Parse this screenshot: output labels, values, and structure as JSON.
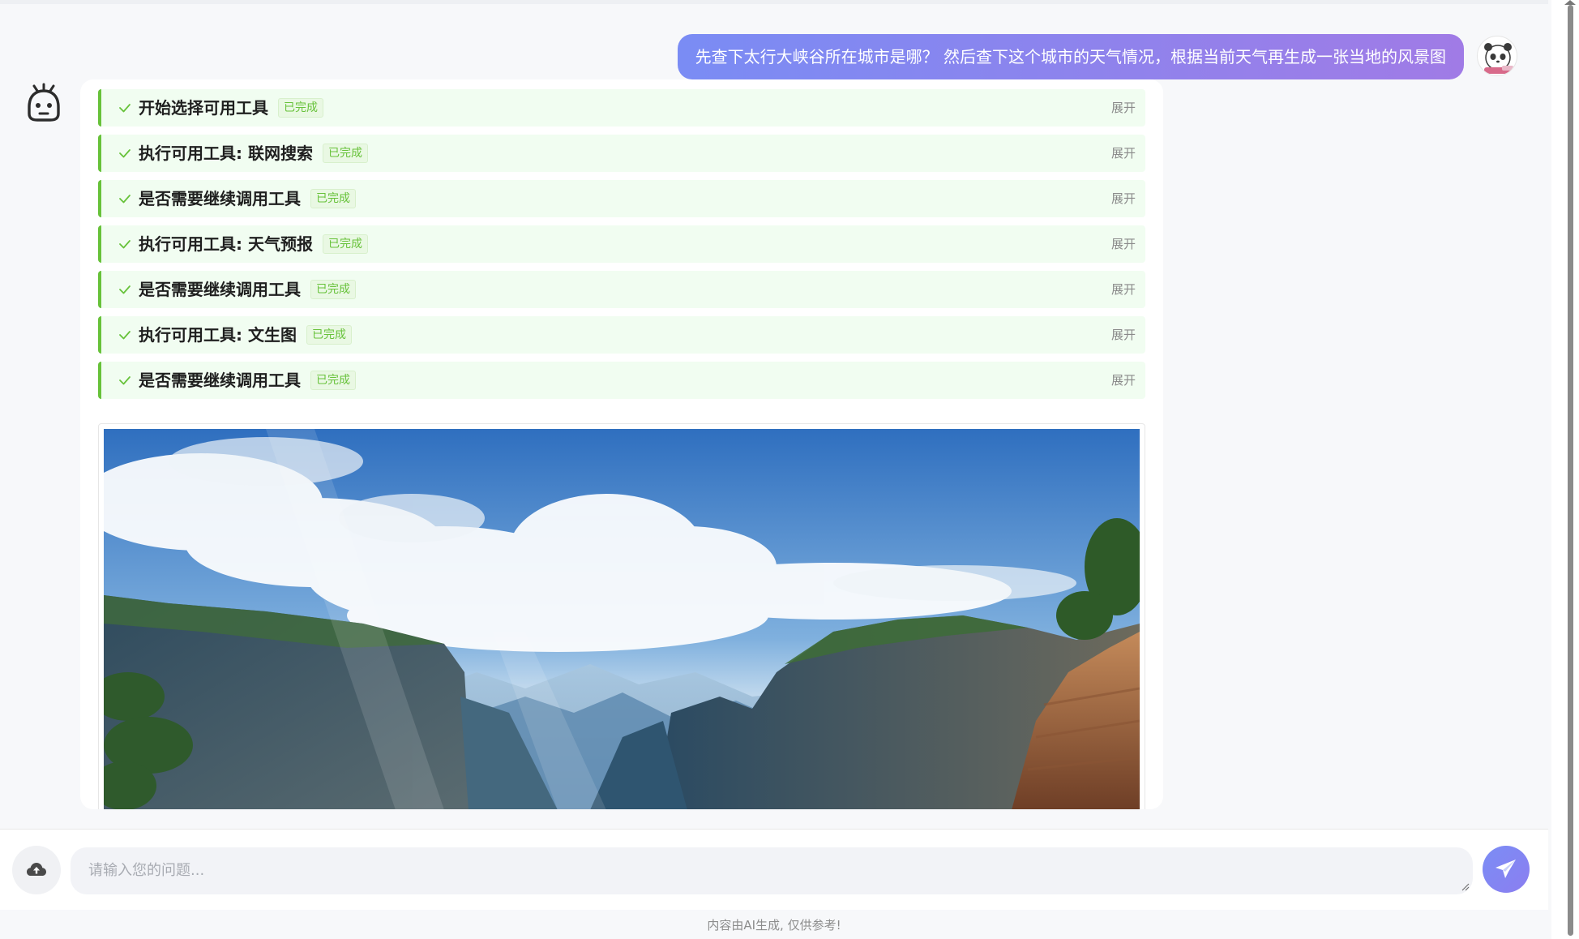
{
  "user_message": {
    "text": "先查下太行大峡谷所在城市是哪？ 然后查下这个城市的天气情况，根据当前天气再生成一张当地的风景图"
  },
  "steps": [
    {
      "title": "开始选择可用工具",
      "status": "已完成",
      "expand_label": "展开"
    },
    {
      "title": "执行可用工具: 联网搜索",
      "status": "已完成",
      "expand_label": "展开"
    },
    {
      "title": "是否需要继续调用工具",
      "status": "已完成",
      "expand_label": "展开"
    },
    {
      "title": "执行可用工具: 天气预报",
      "status": "已完成",
      "expand_label": "展开"
    },
    {
      "title": "是否需要继续调用工具",
      "status": "已完成",
      "expand_label": "展开"
    },
    {
      "title": "执行可用工具: 文生图",
      "status": "已完成",
      "expand_label": "展开"
    },
    {
      "title": "是否需要继续调用工具",
      "status": "已完成",
      "expand_label": "展开"
    }
  ],
  "input": {
    "placeholder": "请输入您的问题...",
    "value": ""
  },
  "footer": {
    "note": "内容由AI生成, 仅供参考!"
  },
  "icons": {
    "upload": "cloud-upload-icon",
    "send": "paper-plane-icon",
    "step_status": "check-icon",
    "bot": "robot-icon"
  },
  "colors": {
    "accent_start": "#7a8cf4",
    "accent_end": "#a07be6",
    "success": "#67c23a",
    "step_bg": "#f1fdf1"
  }
}
